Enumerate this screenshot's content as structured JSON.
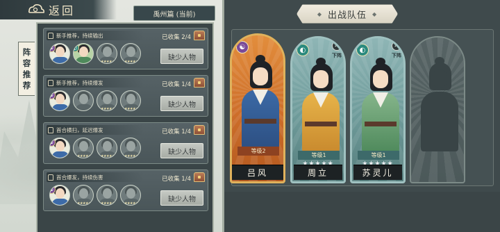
{
  "header": {
    "back_label": "返回",
    "region_label": "禹州篇 (当前)"
  },
  "side_tab": {
    "chars": [
      "阵",
      "容",
      "推",
      "荐"
    ]
  },
  "recommendations": [
    {
      "title": "新手推荐，持续输出",
      "collected": "已收集 2/4",
      "button": "缺少人物",
      "owned": [
        true,
        true,
        false,
        false
      ]
    },
    {
      "title": "新手推荐，持续爆发",
      "collected": "已收集 1/4",
      "button": "缺少人物",
      "owned": [
        true,
        false,
        false,
        false
      ]
    },
    {
      "title": "首合横扫，延迟爆发",
      "collected": "已收集 1/4",
      "button": "缺少人物",
      "owned": [
        true,
        false,
        false,
        false
      ]
    },
    {
      "title": "首合爆发，持续伤害",
      "collected": "已收集 1/4",
      "button": "缺少人物",
      "owned": [
        true,
        false,
        false,
        false
      ]
    }
  ],
  "team": {
    "title": "出战队伍",
    "slots": [
      {
        "name": "吕风",
        "level": "等级2",
        "stars": "",
        "element": "yin-yang-icon",
        "removable": false
      },
      {
        "name": "周立",
        "level": "等级1",
        "stars": "★★★★★",
        "element": "wind-icon",
        "removable": true,
        "remove_label": "下阵"
      },
      {
        "name": "苏灵儿",
        "level": "等级1",
        "stars": "★★★★★",
        "element": "wind-icon",
        "removable": true,
        "remove_label": "下阵"
      }
    ]
  },
  "colors": {
    "panel_dark": "#3a4547",
    "gold_frame": "#e0b25c",
    "teal_frame": "#9fc1c0"
  }
}
